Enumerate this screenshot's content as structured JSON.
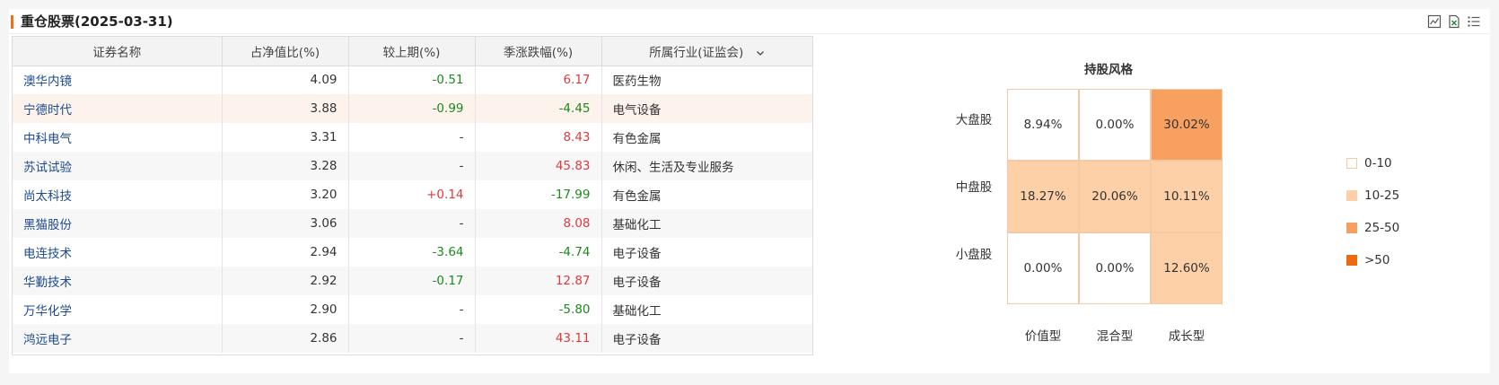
{
  "title": "重仓股票(2025-03-31)",
  "tools": [
    {
      "name": "chart-icon",
      "label": "chart"
    },
    {
      "name": "excel-export-icon",
      "label": "export"
    },
    {
      "name": "list-icon",
      "label": "list"
    }
  ],
  "colors": {
    "accent": "#e8731c",
    "up": "#e0393e",
    "down": "#1a8a1a",
    "link": "#1d4a8c",
    "lg0": "#ffffff",
    "lg1": "#fdd0a8",
    "lg2": "#f7a060",
    "lg3": "#ee6a10"
  },
  "table": {
    "headers": [
      "证券名称",
      "占净值比(%)",
      "较上期(%)",
      "季涨跌幅(%)",
      "所属行业(证监会)"
    ],
    "rows": [
      {
        "name": "澳华内镜",
        "ratio": "4.09",
        "change": "-0.51",
        "qchg": "6.17",
        "industry": "医药生物"
      },
      {
        "name": "宁德时代",
        "ratio": "3.88",
        "change": "-0.99",
        "qchg": "-4.45",
        "industry": "电气设备"
      },
      {
        "name": "中科电气",
        "ratio": "3.31",
        "change": "-",
        "qchg": "8.43",
        "industry": "有色金属"
      },
      {
        "name": "苏试试验",
        "ratio": "3.28",
        "change": "-",
        "qchg": "45.83",
        "industry": "休闲、生活及专业服务"
      },
      {
        "name": "尚太科技",
        "ratio": "3.20",
        "change": "+0.14",
        "qchg": "-17.99",
        "industry": "有色金属"
      },
      {
        "name": "黑猫股份",
        "ratio": "3.06",
        "change": "-",
        "qchg": "8.08",
        "industry": "基础化工"
      },
      {
        "name": "电连技术",
        "ratio": "2.94",
        "change": "-3.64",
        "qchg": "-4.74",
        "industry": "电子设备"
      },
      {
        "name": "华勤技术",
        "ratio": "2.92",
        "change": "-0.17",
        "qchg": "12.87",
        "industry": "电子设备"
      },
      {
        "name": "万华化学",
        "ratio": "2.90",
        "change": "-",
        "qchg": "-5.80",
        "industry": "基础化工"
      },
      {
        "name": "鸿远电子",
        "ratio": "2.86",
        "change": "-",
        "qchg": "43.11",
        "industry": "电子设备"
      }
    ]
  },
  "chart_data": {
    "type": "heatmap",
    "title": "持股风格",
    "rows": [
      "大盘股",
      "中盘股",
      "小盘股"
    ],
    "cols": [
      "价值型",
      "混合型",
      "成长型"
    ],
    "values": [
      [
        "8.94%",
        "0.00%",
        "30.02%"
      ],
      [
        "18.27%",
        "20.06%",
        "10.11%"
      ],
      [
        "0.00%",
        "0.00%",
        "12.60%"
      ]
    ],
    "numeric": [
      [
        8.94,
        0.0,
        30.02
      ],
      [
        18.27,
        20.06,
        10.11
      ],
      [
        0.0,
        0.0,
        12.6
      ]
    ],
    "legend": [
      "0-10",
      "10-25",
      "25-50",
      ">50"
    ]
  }
}
